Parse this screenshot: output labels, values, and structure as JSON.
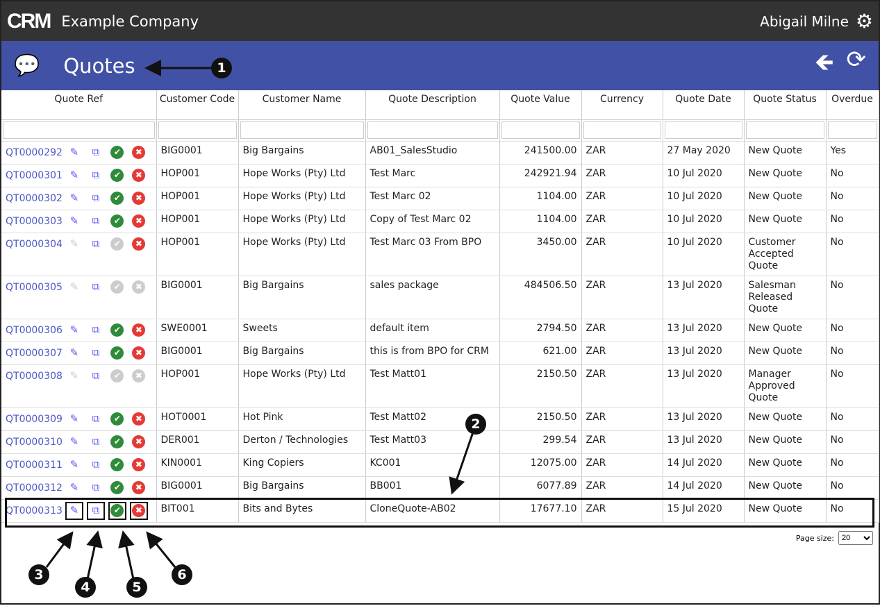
{
  "header": {
    "logo": "CRM",
    "company": "Example Company",
    "user": "Abigail Milne"
  },
  "page": {
    "title": "Quotes"
  },
  "columns": [
    "Quote Ref",
    "Customer Code",
    "Customer Name",
    "Quote Description",
    "Quote Value",
    "Currency",
    "Quote Date",
    "Quote Status",
    "Overdue"
  ],
  "rows": [
    {
      "ref": "QT0000292",
      "code": "BIG0001",
      "name": "Big Bargains",
      "desc": "AB01_SalesStudio",
      "value": "241500.00",
      "cur": "ZAR",
      "date": "27 May 2020",
      "status": "New Quote",
      "overdue": "Yes",
      "enabled": true
    },
    {
      "ref": "QT0000301",
      "code": "HOP001",
      "name": "Hope Works (Pty) Ltd",
      "desc": "Test Marc",
      "value": "242921.94",
      "cur": "ZAR",
      "date": "10 Jul 2020",
      "status": "New Quote",
      "overdue": "No",
      "enabled": true
    },
    {
      "ref": "QT0000302",
      "code": "HOP001",
      "name": "Hope Works (Pty) Ltd",
      "desc": "Test Marc 02",
      "value": "1104.00",
      "cur": "ZAR",
      "date": "10 Jul 2020",
      "status": "New Quote",
      "overdue": "No",
      "enabled": true
    },
    {
      "ref": "QT0000303",
      "code": "HOP001",
      "name": "Hope Works (Pty) Ltd",
      "desc": "Copy of Test Marc 02",
      "value": "1104.00",
      "cur": "ZAR",
      "date": "10 Jul 2020",
      "status": "New Quote",
      "overdue": "No",
      "enabled": true
    },
    {
      "ref": "QT0000304",
      "code": "HOP001",
      "name": "Hope Works (Pty) Ltd",
      "desc": "Test Marc 03 From BPO",
      "value": "3450.00",
      "cur": "ZAR",
      "date": "10 Jul 2020",
      "status": "Customer Accepted Quote",
      "overdue": "No",
      "enabled": false,
      "reject_enabled": true
    },
    {
      "ref": "QT0000305",
      "code": "BIG0001",
      "name": "Big Bargains",
      "desc": "sales package",
      "value": "484506.50",
      "cur": "ZAR",
      "date": "13 Jul 2020",
      "status": "Salesman Released Quote",
      "overdue": "No",
      "enabled": false
    },
    {
      "ref": "QT0000306",
      "code": "SWE0001",
      "name": "Sweets",
      "desc": "default item",
      "value": "2794.50",
      "cur": "ZAR",
      "date": "13 Jul 2020",
      "status": "New Quote",
      "overdue": "No",
      "enabled": true
    },
    {
      "ref": "QT0000307",
      "code": "BIG0001",
      "name": "Big Bargains",
      "desc": "this is from BPO for CRM",
      "value": "621.00",
      "cur": "ZAR",
      "date": "13 Jul 2020",
      "status": "New Quote",
      "overdue": "No",
      "enabled": true
    },
    {
      "ref": "QT0000308",
      "code": "HOP001",
      "name": "Hope Works (Pty) Ltd",
      "desc": "Test Matt01",
      "value": "2150.50",
      "cur": "ZAR",
      "date": "13 Jul 2020",
      "status": "Manager Approved Quote",
      "overdue": "No",
      "enabled": false
    },
    {
      "ref": "QT0000309",
      "code": "HOT0001",
      "name": "Hot Pink",
      "desc": "Test Matt02",
      "value": "2150.50",
      "cur": "ZAR",
      "date": "13 Jul 2020",
      "status": "New Quote",
      "overdue": "No",
      "enabled": true
    },
    {
      "ref": "QT0000310",
      "code": "DER001",
      "name": "Derton / Technologies",
      "desc": "Test Matt03",
      "value": "299.54",
      "cur": "ZAR",
      "date": "13 Jul 2020",
      "status": "New Quote",
      "overdue": "No",
      "enabled": true
    },
    {
      "ref": "QT0000311",
      "code": "KIN0001",
      "name": "King Copiers",
      "desc": "KC001",
      "value": "12075.00",
      "cur": "ZAR",
      "date": "14 Jul 2020",
      "status": "New Quote",
      "overdue": "No",
      "enabled": true
    },
    {
      "ref": "QT0000312",
      "code": "BIG0001",
      "name": "Big Bargains",
      "desc": "BB001",
      "value": "6077.89",
      "cur": "ZAR",
      "date": "14 Jul 2020",
      "status": "New Quote",
      "overdue": "No",
      "enabled": true
    },
    {
      "ref": "QT0000313",
      "code": "BIT001",
      "name": "Bits and Bytes",
      "desc": "CloneQuote-AB02",
      "value": "17677.10",
      "cur": "ZAR",
      "date": "15 Jul 2020",
      "status": "New Quote",
      "overdue": "No",
      "enabled": true
    }
  ],
  "pager": {
    "label": "Page size:",
    "value": "20"
  },
  "callouts": [
    "1",
    "2",
    "3",
    "4",
    "5",
    "6"
  ]
}
